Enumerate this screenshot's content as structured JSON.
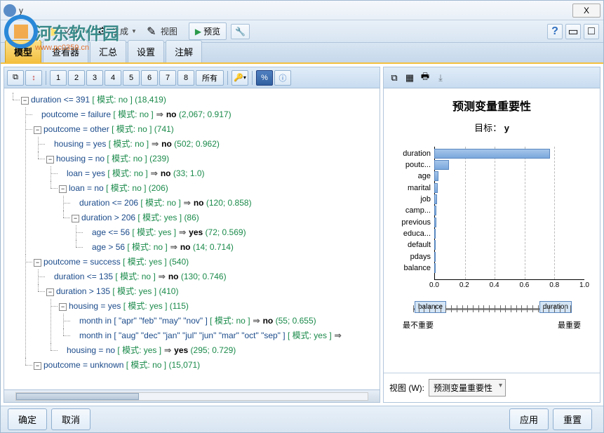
{
  "window": {
    "title": "y",
    "close": "X"
  },
  "watermark": {
    "text": "河东软件园",
    "sub": "www.pc0359.cn"
  },
  "menu": {
    "file": "文件",
    "generate": "生成",
    "view": "视图",
    "preview": "预览"
  },
  "tabs": {
    "model": "模型",
    "viewer": "查看器",
    "summary": "汇总",
    "settings": "设置",
    "annotate": "注解"
  },
  "levels": {
    "all": "所有"
  },
  "tree": [
    {
      "d": 0,
      "e": "−",
      "cond": "duration <= 391",
      "mode": "[ 模式: no ]",
      "stats": "(18,419)"
    },
    {
      "d": 1,
      "leaf": true,
      "cond": "poutcome = failure",
      "mode": "[ 模式: no ]",
      "arrow": true,
      "res": "no",
      "stats": "(2,067; 0.917)"
    },
    {
      "d": 1,
      "e": "−",
      "cond": "poutcome = other",
      "mode": "[ 模式: no ]",
      "stats": "(741)"
    },
    {
      "d": 2,
      "leaf": true,
      "cond": "housing = yes",
      "mode": "[ 模式: no ]",
      "arrow": true,
      "res": "no",
      "stats": "(502; 0.962)"
    },
    {
      "d": 2,
      "e": "−",
      "cond": "housing = no",
      "mode": "[ 模式: no ]",
      "stats": "(239)"
    },
    {
      "d": 3,
      "leaf": true,
      "cond": "loan = yes",
      "mode": "[ 模式: no ]",
      "arrow": true,
      "res": "no",
      "stats": "(33; 1.0)"
    },
    {
      "d": 3,
      "e": "−",
      "cond": "loan = no",
      "mode": "[ 模式: no ]",
      "stats": "(206)"
    },
    {
      "d": 4,
      "leaf": true,
      "cond": "duration <= 206",
      "mode": "[ 模式: no ]",
      "arrow": true,
      "res": "no",
      "stats": "(120; 0.858)"
    },
    {
      "d": 4,
      "e": "−",
      "cond": "duration > 206",
      "mode": "[ 模式: yes ]",
      "stats": "(86)"
    },
    {
      "d": 5,
      "leaf": true,
      "cond": "age <= 56",
      "mode": "[ 模式: yes ]",
      "arrow": true,
      "res": "yes",
      "stats": "(72; 0.569)"
    },
    {
      "d": 5,
      "leaf": true,
      "cond": "age > 56",
      "mode": "[ 模式: no ]",
      "arrow": true,
      "res": "no",
      "stats": "(14; 0.714)"
    },
    {
      "d": 1,
      "e": "−",
      "cond": "poutcome = success",
      "mode": "[ 模式: yes ]",
      "stats": "(540)"
    },
    {
      "d": 2,
      "leaf": true,
      "cond": "duration <= 135",
      "mode": "[ 模式: no ]",
      "arrow": true,
      "res": "no",
      "stats": "(130; 0.746)"
    },
    {
      "d": 2,
      "e": "−",
      "cond": "duration > 135",
      "mode": "[ 模式: yes ]",
      "stats": "(410)"
    },
    {
      "d": 3,
      "e": "−",
      "cond": "housing = yes",
      "mode": "[ 模式: yes ]",
      "stats": "(115)"
    },
    {
      "d": 4,
      "leaf": true,
      "cond": "month in [ \"apr\" \"feb\" \"may\" \"nov\" ]",
      "mode": "[ 模式: no ]",
      "arrow": true,
      "res": "no",
      "stats": "(55; 0.655)"
    },
    {
      "d": 4,
      "leaf": true,
      "cond": "month in [ \"aug\" \"dec\" \"jan\" \"jul\" \"jun\" \"mar\" \"oct\" \"sep\" ]",
      "mode": "[ 模式: yes ]",
      "arrow": true,
      "res": ""
    },
    {
      "d": 3,
      "leaf": true,
      "cond": "housing = no",
      "mode": "[ 模式: yes ]",
      "arrow": true,
      "res": "yes",
      "stats": "(295; 0.729)"
    },
    {
      "d": 1,
      "e": "−",
      "cond": "poutcome = unknown",
      "mode": "[ 模式: no ]",
      "stats": "(15,071)"
    }
  ],
  "chart": {
    "title": "预测变量重要性",
    "target_label": "目标：",
    "target": "y",
    "slider": {
      "left_box": "balance",
      "right_box": "duration",
      "left_lbl": "最不重要",
      "right_lbl": "最重要"
    },
    "view_label": "视图 (W):",
    "view_value": "预测变量重要性"
  },
  "chart_data": {
    "type": "bar",
    "orientation": "horizontal",
    "categories": [
      "duration",
      "poutc...",
      "age",
      "marital",
      "job",
      "camp...",
      "previous",
      "educa...",
      "default",
      "pdays",
      "balance"
    ],
    "values": [
      0.77,
      0.1,
      0.03,
      0.025,
      0.02,
      0.015,
      0.012,
      0.01,
      0.008,
      0.006,
      0.004
    ],
    "xticks": [
      0.0,
      0.2,
      0.4,
      0.6,
      0.8,
      1.0
    ],
    "xlim": [
      0,
      1.0
    ]
  },
  "footer": {
    "ok": "确定",
    "cancel": "取消",
    "apply": "应用",
    "reset": "重置"
  }
}
